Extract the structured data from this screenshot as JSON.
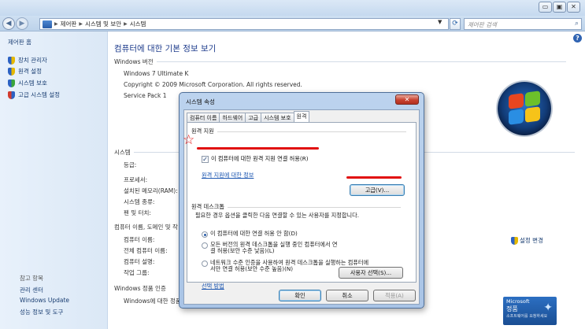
{
  "window": {
    "min_glyph": "▭",
    "max_glyph": "▣",
    "close_glyph": "✕"
  },
  "nav": {
    "back_glyph": "◀",
    "forward_glyph": "▶",
    "breadcrumbs": [
      "제어판",
      "시스템 및 보안",
      "시스템"
    ],
    "search_placeholder": "제어판 검색"
  },
  "sidebar": {
    "home": "제어판 홈",
    "tasks": [
      "장치 관리자",
      "원격 설정",
      "시스템 보호",
      "고급 시스템 설정"
    ],
    "see_also": "참고 항목",
    "links": [
      "관리 센터",
      "Windows Update",
      "성능 정보 및 도구"
    ]
  },
  "main": {
    "title": "컴퓨터에 대한 기본 정보 보기",
    "edition_section": "Windows 버전",
    "edition": "Windows 7 Ultimate K",
    "copyright": "Copyright © 2009 Microsoft Corporation. All rights reserved.",
    "service_pack": "Service Pack 1",
    "system_section": "시스템",
    "system_labels": [
      "등급:",
      "프로세서:",
      "설치된 메모리(RAM):",
      "시스템 종류:",
      "펜 및 터치:"
    ],
    "name_section": "컴퓨터 이름, 도메인 및 작",
    "name_labels": [
      "컴퓨터 이름:",
      "전체 컴퓨터 이름:",
      "컴퓨터 설명:",
      "작업 그룹:"
    ],
    "change_settings": "설정 변경",
    "activation_section": "Windows 정품 인증",
    "activation_text": "Windows에 대한 정품",
    "genuine_badge": {
      "line1": "Microsoft",
      "line2": "정품",
      "line3": "소프트웨어를 요청하세요"
    }
  },
  "dialog": {
    "title": "시스템 속성",
    "close_glyph": "✕",
    "tabs": [
      "컴퓨터 이름",
      "하드웨어",
      "고급",
      "시스템 보호",
      "원격"
    ],
    "active_tab": "원격",
    "remote_assist_group": "원격 지원",
    "allow_assist": "이 컴퓨터에 대한 원격 지원 연결 허용(R)",
    "allow_assist_checked": true,
    "assist_info_link": "원격 지원에 대한 정보",
    "advanced_button": "고급(V)...",
    "remote_desktop_group": "원격 데스크톱",
    "rd_description": "필요한 경우 옵션을 클릭한 다음 연결할 수 있는 사용자를 지정합니다.",
    "rd_options": [
      {
        "line1": "이 컴퓨터에 대한 연결 허용 안 함(D)",
        "line2": "",
        "selected": true
      },
      {
        "line1": "모든 버전의 원격 데스크톱을 실행 중인 컴퓨터에서 연",
        "line2": "결 허용(보안 수준 낮음)(L)",
        "selected": false
      },
      {
        "line1": "네트워크 수준 인증을 사용하여 원격 데스크톱을 실행하는 컴퓨터에",
        "line2": "서만 연결 허용(보안 수준 높음)(N)",
        "selected": false
      }
    ],
    "choose_link": "선택 방법",
    "select_users_button": "사용자 선택(S)...",
    "ok": "확인",
    "cancel": "취소",
    "apply": "적용(A)"
  },
  "annotation": {
    "color": "#e11010",
    "star_glyph": "☆"
  }
}
